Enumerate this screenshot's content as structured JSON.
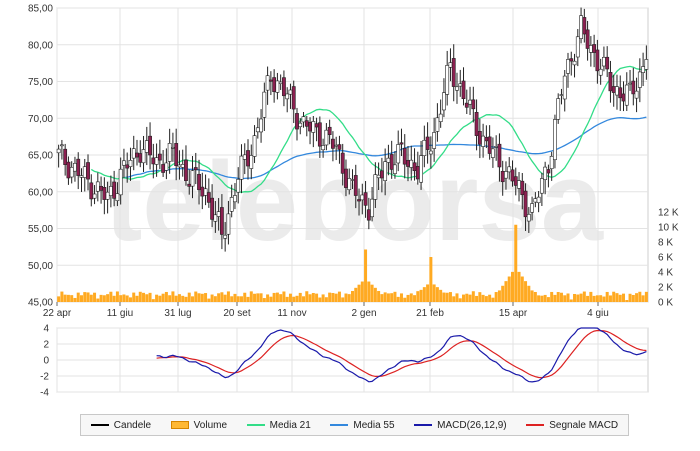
{
  "watermark": "telebörsa",
  "colors": {
    "candle_up": "#ffffff",
    "candle_down": "#8b2050",
    "candle_border": "#222222",
    "volume": "#ffaa22",
    "ma21": "#33dd88",
    "ma55": "#3388dd",
    "macd": "#1a1aaa",
    "signal": "#dd2222",
    "grid": "#e3e3e3"
  },
  "legend": [
    {
      "label": "Candele",
      "color": "#000000",
      "kind": "line"
    },
    {
      "label": "Volume",
      "color": "#ffb833",
      "kind": "box"
    },
    {
      "label": "Media 21",
      "color": "#33dd88",
      "kind": "line"
    },
    {
      "label": "Media 55",
      "color": "#3388dd",
      "kind": "line"
    },
    {
      "label": "MACD(26,12,9)",
      "color": "#1a1aaa",
      "kind": "line"
    },
    {
      "label": "Segnale MACD",
      "color": "#dd2222",
      "kind": "line"
    }
  ],
  "chart_data": [
    {
      "type": "candlestick",
      "title": "",
      "x_ticks": [
        "22 apr",
        "11 giu",
        "31 lug",
        "20 set",
        "11 nov",
        "2 gen",
        "21 feb",
        "15 apr",
        "4 giu"
      ],
      "ylim": [
        45,
        85
      ],
      "y_ticks": [
        "45,00",
        "50,00",
        "55,00",
        "60,00",
        "65,00",
        "70,00",
        "75,00",
        "80,00",
        "85,00"
      ],
      "grid": true,
      "closes_weekly_approx": [
        65,
        63,
        61,
        59,
        63,
        66,
        64,
        65,
        62,
        60,
        54,
        62,
        67,
        76,
        73,
        69,
        68,
        66,
        60,
        58,
        64,
        65,
        63,
        68,
        77,
        72,
        67,
        64,
        61,
        57,
        64,
        76,
        82,
        78,
        74,
        73,
        78
      ]
    },
    {
      "type": "bar",
      "series": "Volume",
      "y_ticks": [
        "0 K",
        "2 K",
        "4 K",
        "6 K",
        "8 K",
        "10 K",
        "12 K"
      ],
      "ylim": [
        0,
        12000
      ],
      "spikes_approx": [
        {
          "near": "2 gen",
          "value": 7000
        },
        {
          "near": "21 feb",
          "value": 6000
        },
        {
          "near": "15 apr",
          "value": 10300
        }
      ]
    },
    {
      "type": "line",
      "series": [
        "MACD(26,12,9)",
        "Segnale MACD"
      ],
      "ylim": [
        -4,
        4
      ],
      "y_ticks": [
        "4",
        "2",
        "0",
        "-2",
        "-4"
      ]
    }
  ]
}
